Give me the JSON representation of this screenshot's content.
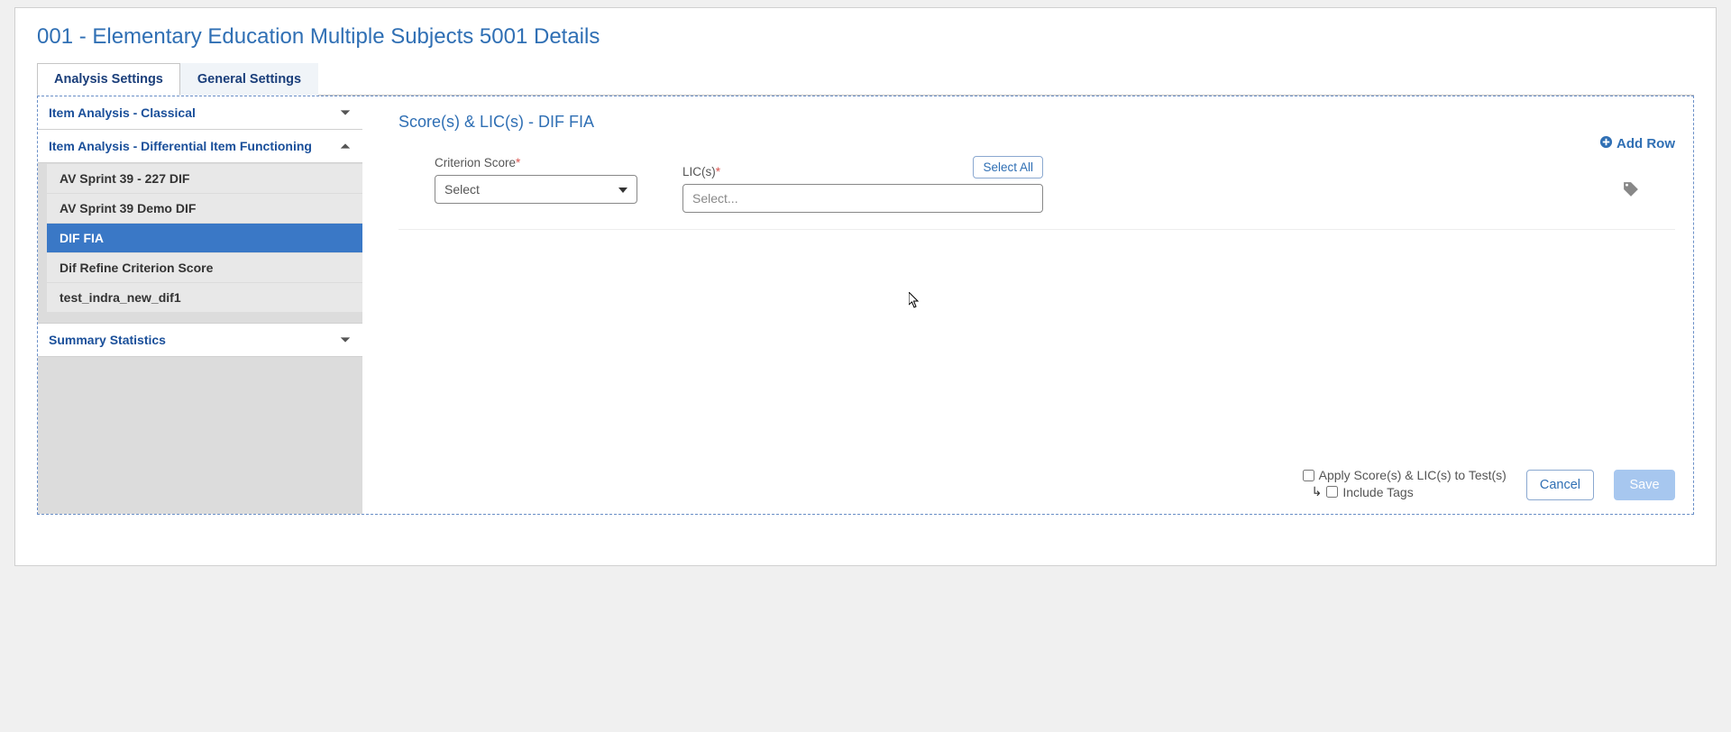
{
  "page": {
    "title": "001 - Elementary Education Multiple Subjects 5001 Details"
  },
  "tabs": {
    "analysis": "Analysis Settings",
    "general": "General Settings"
  },
  "sidebar": {
    "acc1": {
      "title": "Item Analysis - Classical"
    },
    "acc2": {
      "title": "Item Analysis - Differential Item Functioning",
      "items": [
        "AV Sprint 39 - 227 DIF",
        "AV Sprint 39 Demo DIF",
        "DIF FIA",
        "Dif Refine Criterion Score",
        "test_indra_new_dif1"
      ]
    },
    "acc3": {
      "title": "Summary Statistics"
    }
  },
  "main": {
    "section_title": "Score(s) & LIC(s) - DIF FIA",
    "add_row": "Add Row",
    "criterion_label": "Criterion Score",
    "criterion_placeholder": "Select",
    "lic_label": "LIC(s)",
    "lic_placeholder": "Select...",
    "select_all": "Select All"
  },
  "footer": {
    "apply_label": "Apply Score(s) & LIC(s) to Test(s)",
    "include_tags": "Include Tags",
    "cancel": "Cancel",
    "save": "Save"
  }
}
